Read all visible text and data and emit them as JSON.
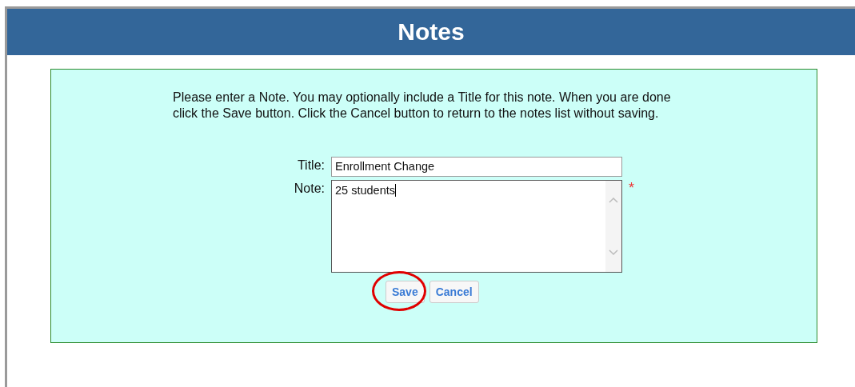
{
  "header": {
    "title": "Notes"
  },
  "instructions": "Please enter a Note. You may optionally include a Title for this note. When you are done click the Save button. Click the Cancel button to return to the notes list without saving.",
  "fields": [
    {
      "kind": "input",
      "label": "Title:",
      "value": "Enrollment Change"
    },
    {
      "kind": "textarea",
      "label": "Note:",
      "value": "25 students",
      "required_mark": "*"
    }
  ],
  "buttons": [
    {
      "label": "Save",
      "highlighted": true
    },
    {
      "label": "Cancel",
      "highlighted": false
    }
  ]
}
